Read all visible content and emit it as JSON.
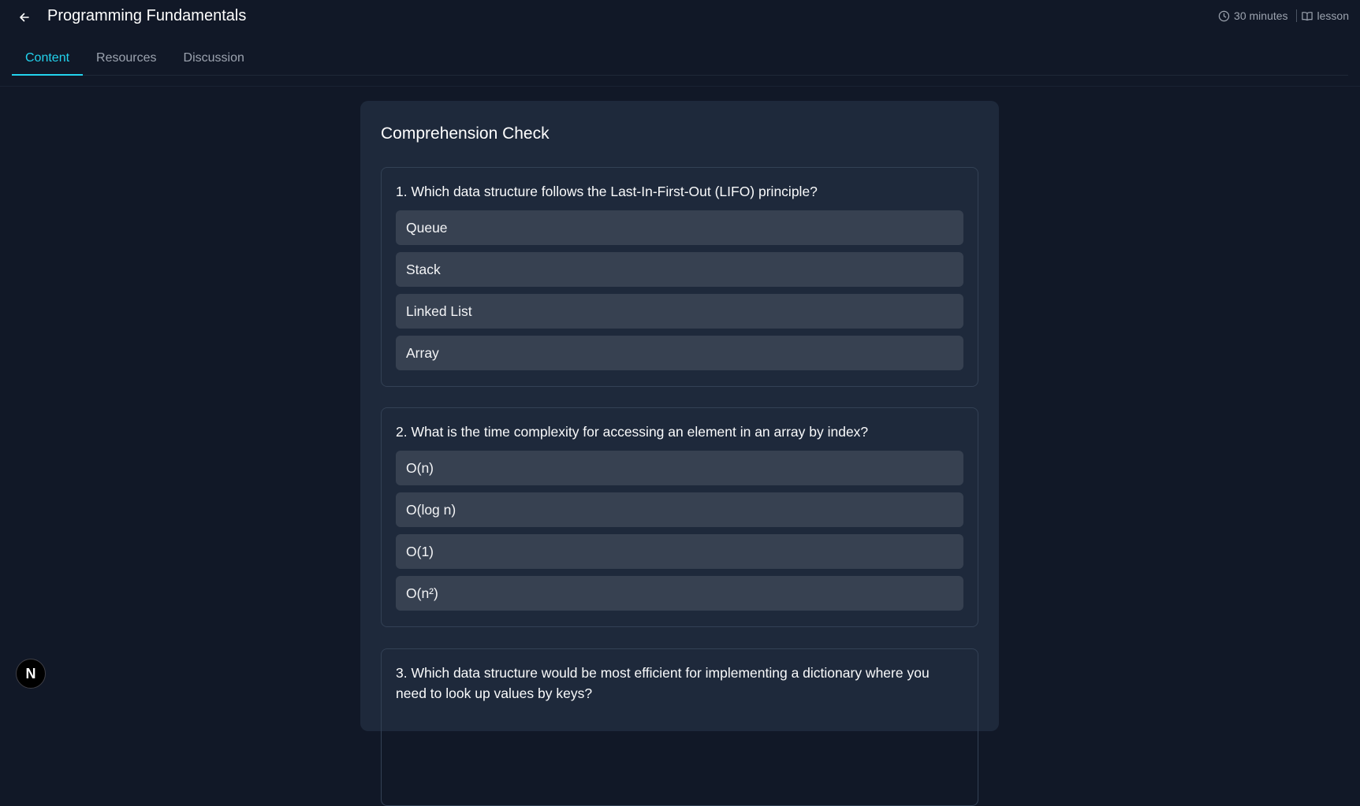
{
  "header": {
    "title": "Programming Fundamentals",
    "back_icon": "arrow-left-icon",
    "duration": "30 minutes",
    "duration_icon": "clock-icon",
    "type": "lesson",
    "type_icon": "book-open-icon"
  },
  "tabs": [
    {
      "label": "Content",
      "active": true
    },
    {
      "label": "Resources",
      "active": false
    },
    {
      "label": "Discussion",
      "active": false
    }
  ],
  "quiz": {
    "title": "Comprehension Check",
    "questions": [
      {
        "text": "1. Which data structure follows the Last-In-First-Out (LIFO) principle?",
        "options": [
          "Queue",
          "Stack",
          "Linked List",
          "Array"
        ]
      },
      {
        "text": "2. What is the time complexity for accessing an element in an array by index?",
        "options": [
          "O(n)",
          "O(log n)",
          "O(1)",
          "O(n²)"
        ]
      },
      {
        "text": "3. Which data structure would be most efficient for implementing a dictionary where you need to look up values by keys?",
        "options": []
      }
    ]
  },
  "badge": {
    "label": "N"
  },
  "colors": {
    "background": "#111827",
    "card": "#1e293b",
    "option": "#374151",
    "accent": "#22d3ee"
  }
}
